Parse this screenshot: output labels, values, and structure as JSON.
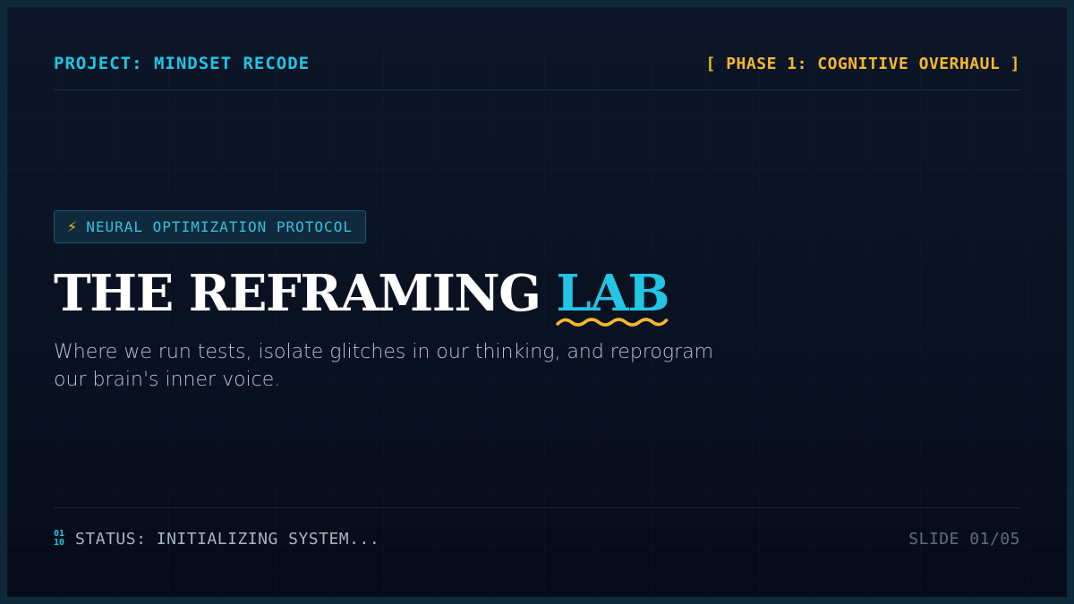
{
  "header": {
    "project": "PROJECT: MINDSET RECODE",
    "phase": "[ PHASE 1: COGNITIVE OVERHAUL ]"
  },
  "badge": {
    "icon": "lightning-bolt-icon",
    "label": "NEURAL OPTIMIZATION PROTOCOL"
  },
  "title": {
    "main": "THE REFRAMING ",
    "accent": "LAB"
  },
  "subtitle": "Where we run tests, isolate glitches in our thinking, and reprogram our brain's inner voice.",
  "footer": {
    "status_icon": "binary-icon",
    "status": "STATUS: INITIALIZING SYSTEM...",
    "slide": "SLIDE 01/05"
  },
  "colors": {
    "cyan_accent": "#22c6e4",
    "gold_accent": "#f4b92b",
    "background": "#0b1424"
  }
}
